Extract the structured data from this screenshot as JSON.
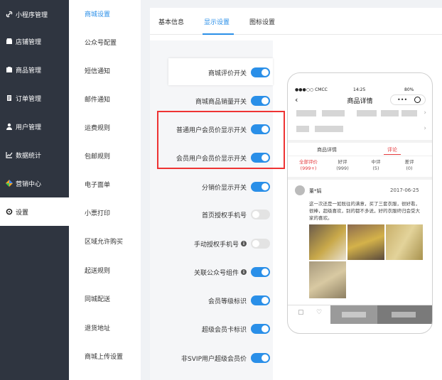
{
  "nav": {
    "items": [
      {
        "label": "小程序管理",
        "icon": "link-icon"
      },
      {
        "label": "店铺管理",
        "icon": "store-icon"
      },
      {
        "label": "商品管理",
        "icon": "product-icon"
      },
      {
        "label": "订单管理",
        "icon": "order-icon"
      },
      {
        "label": "用户管理",
        "icon": "user-icon"
      },
      {
        "label": "数据统计",
        "icon": "chart-icon"
      },
      {
        "label": "营销中心",
        "icon": "marketing-icon"
      },
      {
        "label": "设置",
        "icon": "settings-icon"
      }
    ]
  },
  "subnav": {
    "items": [
      "商城设置",
      "公众号配置",
      "短信通知",
      "邮件通知",
      "运费规则",
      "包邮规则",
      "电子面单",
      "小票打印",
      "区域允许购买",
      "起送规则",
      "同城配送",
      "退货地址",
      "商城上传设置"
    ]
  },
  "tabs": [
    "基本信息",
    "显示设置",
    "图标设置"
  ],
  "settings": [
    {
      "label": "商城评价开关",
      "on": true,
      "info": false
    },
    {
      "label": "商城商品销量开关",
      "on": true,
      "info": false
    },
    {
      "label": "普通用户会员价显示开关",
      "on": true,
      "info": false
    },
    {
      "label": "会员用户会员价显示开关",
      "on": true,
      "info": false
    },
    {
      "label": "分销价显示开关",
      "on": true,
      "info": false
    },
    {
      "label": "首页授权手机号",
      "on": false,
      "info": false
    },
    {
      "label": "手动授权手机号",
      "on": false,
      "info": true
    },
    {
      "label": "关联公众号组件",
      "on": true,
      "info": true
    },
    {
      "label": "会员等级标识",
      "on": true,
      "info": false
    },
    {
      "label": "超级会员卡标识",
      "on": true,
      "info": false
    },
    {
      "label": "非SVIP用户超级会员价",
      "on": true,
      "info": false
    }
  ],
  "phone": {
    "status_left": "●●●○○ CMCC",
    "status_time": "14:25",
    "status_right": "80%",
    "title": "商品详情",
    "tab_detail": "商品详情",
    "tab_review": "评论",
    "filters": [
      {
        "label": "全部评价",
        "count": "(999+)"
      },
      {
        "label": "好评",
        "count": "(999)"
      },
      {
        "label": "中评",
        "count": "(5)"
      },
      {
        "label": "差评",
        "count": "(0)"
      }
    ],
    "reviewer": "董*娟",
    "review_date": "2017-06-25",
    "review_text": "这一次还是一如既往的满意，买了三套衣服，很好看，很棒，超级喜欢，别的都不多说，好的衣服终归会受大家的喜欢。"
  },
  "colors": {
    "accent": "#2a8fe8",
    "nav_bg": "#2f3540",
    "highlight_red": "#ee3333",
    "review_red": "#e4393c"
  }
}
